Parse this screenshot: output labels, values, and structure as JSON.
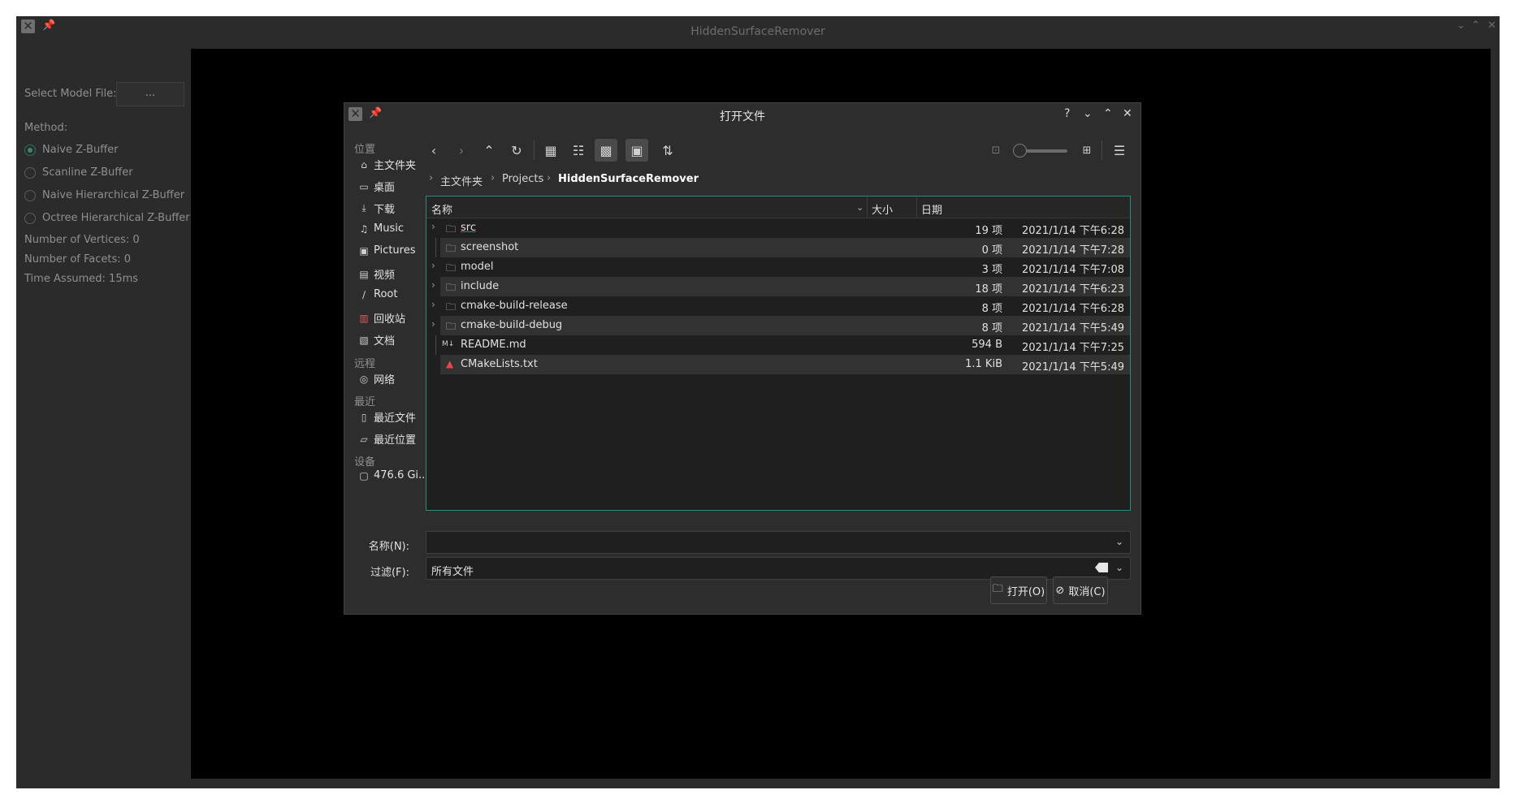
{
  "app": {
    "title": "HiddenSurfaceRemover",
    "select_model_label": "Select Model File:",
    "select_model_button": "...",
    "method_label": "Method:",
    "methods": [
      {
        "label": "Naive Z-Buffer",
        "selected": true
      },
      {
        "label": "Scanline Z-Buffer",
        "selected": false
      },
      {
        "label": "Naive Hierarchical Z-Buffer",
        "selected": false
      },
      {
        "label": "Octree Hierarchical Z-Buffer",
        "selected": false
      }
    ],
    "vertices": "Number of Vertices: 0",
    "facets": "Number of Facets: 0",
    "time": "Time Assumed: 15ms"
  },
  "dialog": {
    "title": "打开文件",
    "help": "?",
    "places_header": "位置",
    "places": [
      {
        "label": "主文件夹",
        "icon": "home-icon"
      },
      {
        "label": "桌面",
        "icon": "desktop-icon"
      },
      {
        "label": "下载",
        "icon": "download-icon"
      },
      {
        "label": "Music",
        "icon": "music-icon"
      },
      {
        "label": "Pictures",
        "icon": "pictures-icon"
      },
      {
        "label": "视频",
        "icon": "video-icon"
      },
      {
        "label": "Root",
        "icon": "root-icon"
      },
      {
        "label": "回收站",
        "icon": "trash-icon"
      },
      {
        "label": "文档",
        "icon": "documents-icon"
      }
    ],
    "remote_header": "远程",
    "network": "网络",
    "recent_header": "最近",
    "recent_files": "最近文件",
    "recent_locations": "最近位置",
    "devices_header": "设备",
    "device": "476.6 Gi...",
    "breadcrumb": [
      "主文件夹",
      "Projects",
      "HiddenSurfaceRemover"
    ],
    "columns": {
      "name": "名称",
      "size": "大小",
      "date": "日期"
    },
    "files": [
      {
        "name": "src",
        "size": "19 项",
        "date": "2021/1/14 下午6:28",
        "type": "folder",
        "expandable": true
      },
      {
        "name": "screenshot",
        "size": "0 项",
        "date": "2021/1/14 下午7:28",
        "type": "folder",
        "expandable": false
      },
      {
        "name": "model",
        "size": "3 项",
        "date": "2021/1/14 下午7:08",
        "type": "folder",
        "expandable": true
      },
      {
        "name": "include",
        "size": "18 项",
        "date": "2021/1/14 下午6:23",
        "type": "folder",
        "expandable": true
      },
      {
        "name": "cmake-build-release",
        "size": "8 项",
        "date": "2021/1/14 下午6:28",
        "type": "folder",
        "expandable": true
      },
      {
        "name": "cmake-build-debug",
        "size": "8 项",
        "date": "2021/1/14 下午5:49",
        "type": "folder",
        "expandable": true
      },
      {
        "name": "README.md",
        "size": "594 B",
        "date": "2021/1/14 下午7:25",
        "type": "markdown",
        "expandable": false
      },
      {
        "name": "CMakeLists.txt",
        "size": "1.1 KiB",
        "date": "2021/1/14 下午5:49",
        "type": "cmake",
        "expandable": false
      }
    ],
    "name_label": "名称(N):",
    "name_value": "",
    "filter_label": "过滤(F):",
    "filter_value": "所有文件",
    "open_button": "打开(O)",
    "cancel_button": "取消(C)"
  },
  "colors": {
    "accent": "#2f8a7c",
    "background": "#2d2d2d",
    "canvas": "#000000"
  }
}
